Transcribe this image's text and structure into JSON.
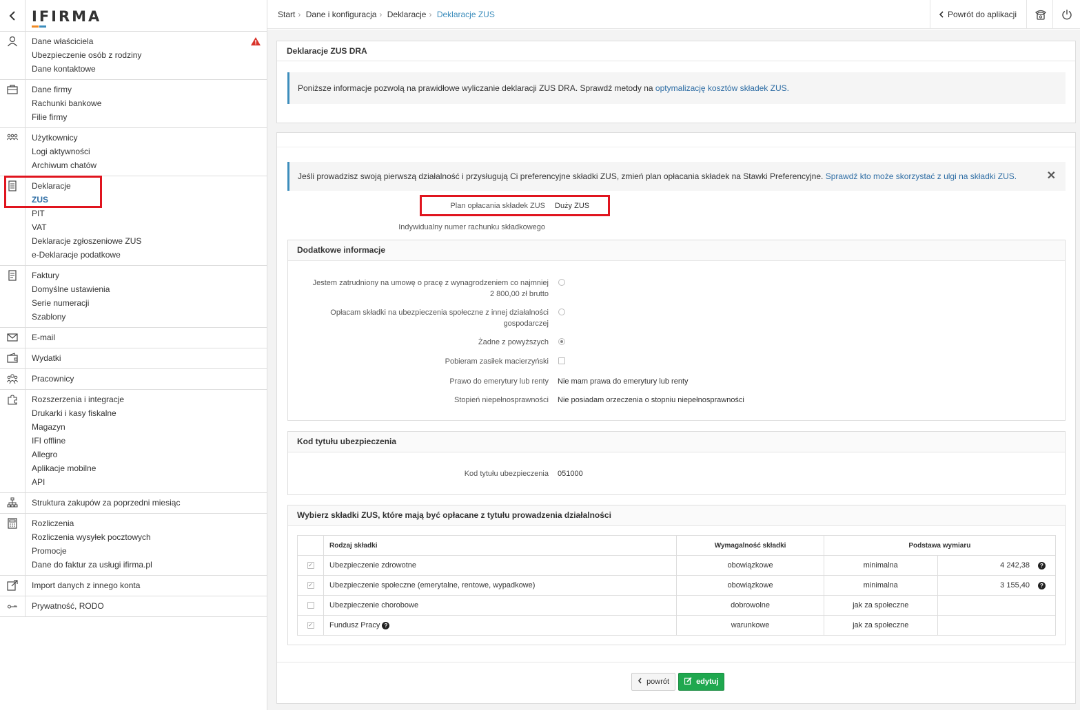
{
  "logo": "IFIRMA",
  "sidebar": {
    "groups": [
      {
        "icon": "user-icon",
        "items": [
          "Dane właściciela",
          "Ubezpieczenie osób z rodziny",
          "Dane kontaktowe"
        ]
      },
      {
        "icon": "briefcase-icon",
        "items": [
          "Dane firmy",
          "Rachunki bankowe",
          "Filie firmy"
        ]
      },
      {
        "icon": "users-icon",
        "items": [
          "Użytkownicy",
          "Logi aktywności",
          "Archiwum chatów"
        ]
      },
      {
        "icon": "document-icon",
        "items": [
          "Deklaracje",
          "ZUS",
          "PIT",
          "VAT",
          "Deklaracje zgłoszeniowe ZUS",
          "e-Deklaracje podatkowe"
        ]
      },
      {
        "icon": "invoice-icon",
        "items": [
          "Faktury",
          "Domyślne ustawienia",
          "Serie numeracji",
          "Szablony"
        ]
      },
      {
        "icon": "envelope-icon",
        "items": [
          "E-mail"
        ]
      },
      {
        "icon": "wallet-icon",
        "items": [
          "Wydatki"
        ]
      },
      {
        "icon": "team-icon",
        "items": [
          "Pracownicy"
        ]
      },
      {
        "icon": "puzzle-icon",
        "items": [
          "Rozszerzenia i integracje",
          "Drukarki i kasy fiskalne",
          "Magazyn",
          "IFI offline",
          "Allegro",
          "Aplikacje mobilne",
          "API"
        ]
      },
      {
        "icon": "hierarchy-icon",
        "items": [
          "Struktura zakupów za poprzedni miesiąc"
        ]
      },
      {
        "icon": "calculator-icon",
        "items": [
          "Rozliczenia",
          "Rozliczenia wysyłek pocztowych",
          "Promocje",
          "Dane do faktur za usługi ifirma.pl"
        ]
      },
      {
        "icon": "import-icon",
        "items": [
          "Import danych z innego konta"
        ]
      },
      {
        "icon": "key-icon",
        "items": [
          "Prywatność, RODO"
        ]
      }
    ]
  },
  "breadcrumb": [
    "Start",
    "Dane i konfiguracja",
    "Deklaracje",
    "Deklaracje ZUS"
  ],
  "topbar": {
    "back_label": "Powrót do aplikacji"
  },
  "panel1": {
    "title": "Deklaracje ZUS DRA",
    "info_text": "Poniższe informacje pozwolą na prawidłowe wyliczanie deklaracji ZUS DRA. Sprawdź metody na ",
    "info_link": "optymalizację kosztów składek ZUS."
  },
  "panel2": {
    "notice_text": "Jeśli prowadzisz swoją pierwszą działalność i przysługują Ci preferencyjne składki ZUS, zmień plan opłacania składek na Stawki Preferencyjne. ",
    "notice_link": "Sprawdź kto może skorzystać z ulgi na składki ZUS.",
    "plan_label": "Plan opłacania składek ZUS",
    "plan_value": "Duży ZUS",
    "account_label": "Indywidualny numer rachunku składkowego",
    "account_value": ""
  },
  "extra": {
    "title": "Dodatkowe informacje",
    "opt1_line1": "Jestem zatrudniony na umowę o pracę z wynagrodzeniem co najmniej",
    "opt1_line2": "2 800,00 zł brutto",
    "opt2_line1": "Opłacam składki na ubezpieczenia społeczne z innej działalności",
    "opt2_line2": "gospodarczej",
    "opt3": "Żadne z powyższych",
    "maternity_label": "Pobieram zasiłek macierzyński",
    "pension_label": "Prawo do emerytury lub renty",
    "pension_value": "Nie mam prawa do emerytury lub renty",
    "disability_label": "Stopień niepełnosprawności",
    "disability_value": "Nie posiadam orzeczenia o stopniu niepełnosprawności"
  },
  "insurance_code": {
    "title": "Kod tytułu ubezpieczenia",
    "label": "Kod tytułu ubezpieczenia",
    "value": "051000"
  },
  "contributions": {
    "title": "Wybierz składki ZUS, które mają być opłacane z tytułu prowadzenia działalności",
    "headers": [
      "Rodzaj składki",
      "Wymagalność składki",
      "Podstawa wymiaru"
    ],
    "rows": [
      {
        "name": "Ubezpieczenie zdrowotne",
        "requirement": "obowiązkowe",
        "basis": "minimalna",
        "amount": "4 242,38",
        "checked": true,
        "help": true
      },
      {
        "name": "Ubezpieczenie społeczne (emerytalne, rentowe, wypadkowe)",
        "requirement": "obowiązkowe",
        "basis": "minimalna",
        "amount": "3 155,40",
        "checked": true,
        "help": true
      },
      {
        "name": "Ubezpieczenie chorobowe",
        "requirement": "dobrowolne",
        "basis": "jak za społeczne",
        "amount": "",
        "checked": false,
        "help": false
      },
      {
        "name": "Fundusz Pracy",
        "requirement": "warunkowe",
        "basis": "jak za społeczne",
        "amount": "",
        "checked": true,
        "help": false
      }
    ]
  },
  "buttons": {
    "back": "powrót",
    "edit": "edytuj"
  }
}
